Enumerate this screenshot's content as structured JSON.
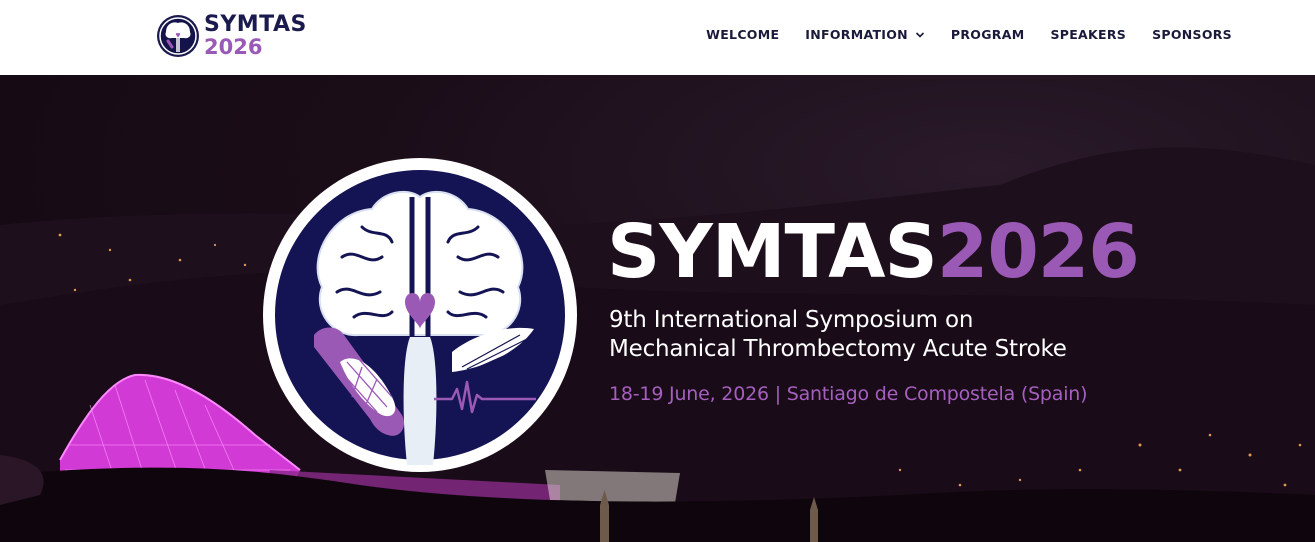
{
  "header": {
    "logo": {
      "word": "SYMTAS",
      "year": "2026"
    },
    "nav": {
      "welcome": "WELCOME",
      "information": "INFORMATION",
      "program": "PROGRAM",
      "speakers": "SPEAKERS",
      "sponsors": "SPONSORS"
    }
  },
  "hero": {
    "title_word": "SYMTAS",
    "title_year": "2026",
    "subtitle_line1": "9th International Symposium on",
    "subtitle_line2": "Mechanical Thrombectomy Acute Stroke",
    "date_location": "18-19 June, 2026 | Santiago de Compostela (Spain)"
  },
  "colors": {
    "brand_navy": "#1a1a4e",
    "brand_purple": "#9b59b6",
    "header_bg": "#ffffff",
    "hero_bg": "#150a14",
    "building_magenta": "#e040e0"
  },
  "icons": {
    "nav_dropdown": "chevron-down-icon",
    "emblem": "brain-tree-emblem"
  }
}
